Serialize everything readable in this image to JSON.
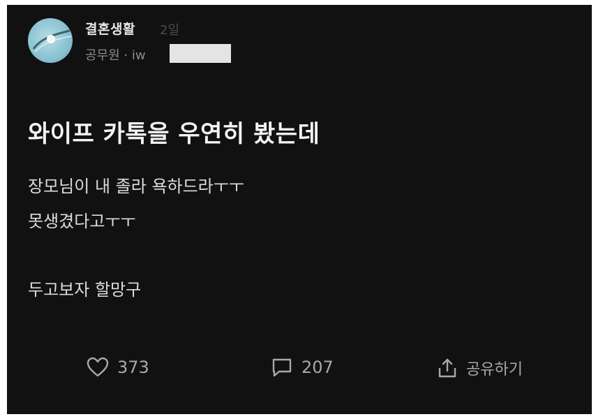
{
  "post": {
    "author": "결혼생활",
    "time": "2일",
    "meta": "공무원 · iw",
    "title": "와이프 카톡을 우연히 봤는데",
    "body": [
      "장모님이 내 졸라 욕하드라ㅜㅜ",
      "못생겼다고ㅜㅜ",
      "두고보자 할망구"
    ]
  },
  "actions": {
    "likes": "373",
    "comments": "207",
    "share_label": "공유하기"
  },
  "icons": {
    "avatar": "ring-avatar",
    "like": "heart-icon",
    "comment": "comment-icon",
    "share": "share-icon"
  },
  "colors": {
    "background": "#111112",
    "text_primary": "#f2f2f2",
    "text_secondary": "#8c8c8e",
    "redaction": "#e4e4e4"
  }
}
